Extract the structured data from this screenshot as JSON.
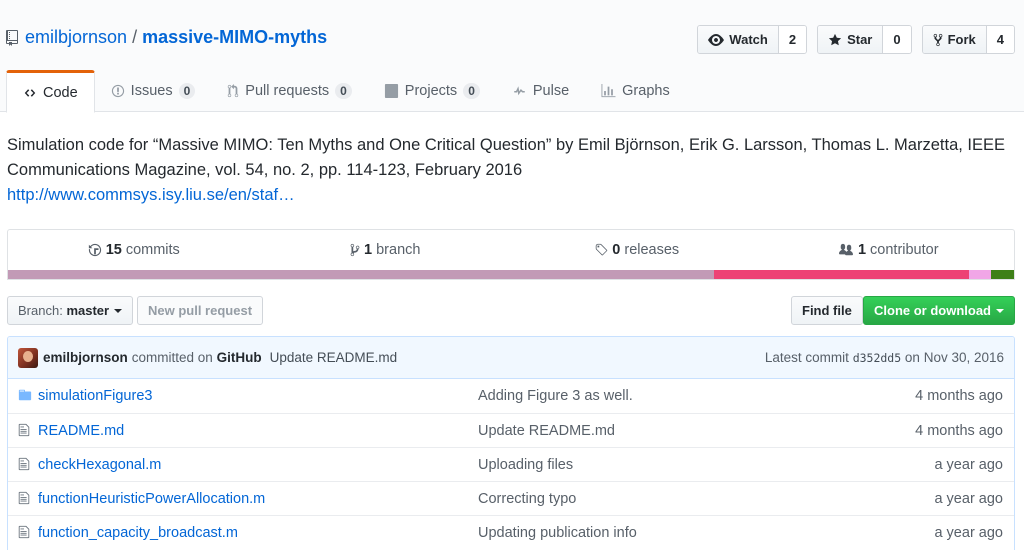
{
  "repo": {
    "owner": "emilbjornson",
    "separator": "/",
    "name": "massive-MIMO-myths"
  },
  "actions": {
    "watch": {
      "label": "Watch",
      "count": "2"
    },
    "star": {
      "label": "Star",
      "count": "0"
    },
    "fork": {
      "label": "Fork",
      "count": "4"
    }
  },
  "tabs": [
    {
      "label": "Code"
    },
    {
      "label": "Issues",
      "count": "0"
    },
    {
      "label": "Pull requests",
      "count": "0"
    },
    {
      "label": "Projects",
      "count": "0"
    },
    {
      "label": "Pulse"
    },
    {
      "label": "Graphs"
    }
  ],
  "description": {
    "text": "Simulation code for “Massive MIMO: Ten Myths and One Critical Question” by Emil Björnson, Erik G. Larsson, Thomas L. Marzetta, IEEE Communications Magazine, vol. 54, no. 2, pp. 114-123, February 2016",
    "link": "http://www.commsys.isy.liu.se/en/staf…"
  },
  "numbers": {
    "commits": {
      "count": "15",
      "label": "commits"
    },
    "branches": {
      "count": "1",
      "label": "branch"
    },
    "releases": {
      "count": "0",
      "label": "releases"
    },
    "contributors": {
      "count": "1",
      "label": "contributor"
    }
  },
  "language_bar": [
    {
      "color": "#c29ab6",
      "percent": 70.2
    },
    {
      "color": "#ed4275",
      "percent": 25.3
    },
    {
      "color": "#f1a6e7",
      "percent": 2.2
    },
    {
      "color": "#3e8018",
      "percent": 2.3
    }
  ],
  "filenav": {
    "branch_prefix": "Branch:",
    "branch_name": "master",
    "new_pr": "New pull request",
    "find_file": "Find file",
    "clone": "Clone or download"
  },
  "latest_commit": {
    "author": "emilbjornson",
    "action": "committed on",
    "platform": "GitHub",
    "message": "Update README.md",
    "prefix": "Latest commit",
    "sha": "d352dd5",
    "date": "on Nov 30, 2016"
  },
  "files": [
    {
      "type": "dir",
      "icon": "folder-icon",
      "name": "simulationFigure3",
      "message": "Adding Figure 3 as well.",
      "age": "4 months ago"
    },
    {
      "type": "file",
      "icon": "file-icon",
      "name": "README.md",
      "message": "Update README.md",
      "age": "4 months ago"
    },
    {
      "type": "file",
      "icon": "file-icon",
      "name": "checkHexagonal.m",
      "message": "Uploading files",
      "age": "a year ago"
    },
    {
      "type": "file",
      "icon": "file-icon",
      "name": "functionHeuristicPowerAllocation.m",
      "message": "Correcting typo",
      "age": "a year ago"
    },
    {
      "type": "file",
      "icon": "file-icon",
      "name": "function_capacity_broadcast.m",
      "message": "Updating publication info",
      "age": "a year ago"
    }
  ]
}
